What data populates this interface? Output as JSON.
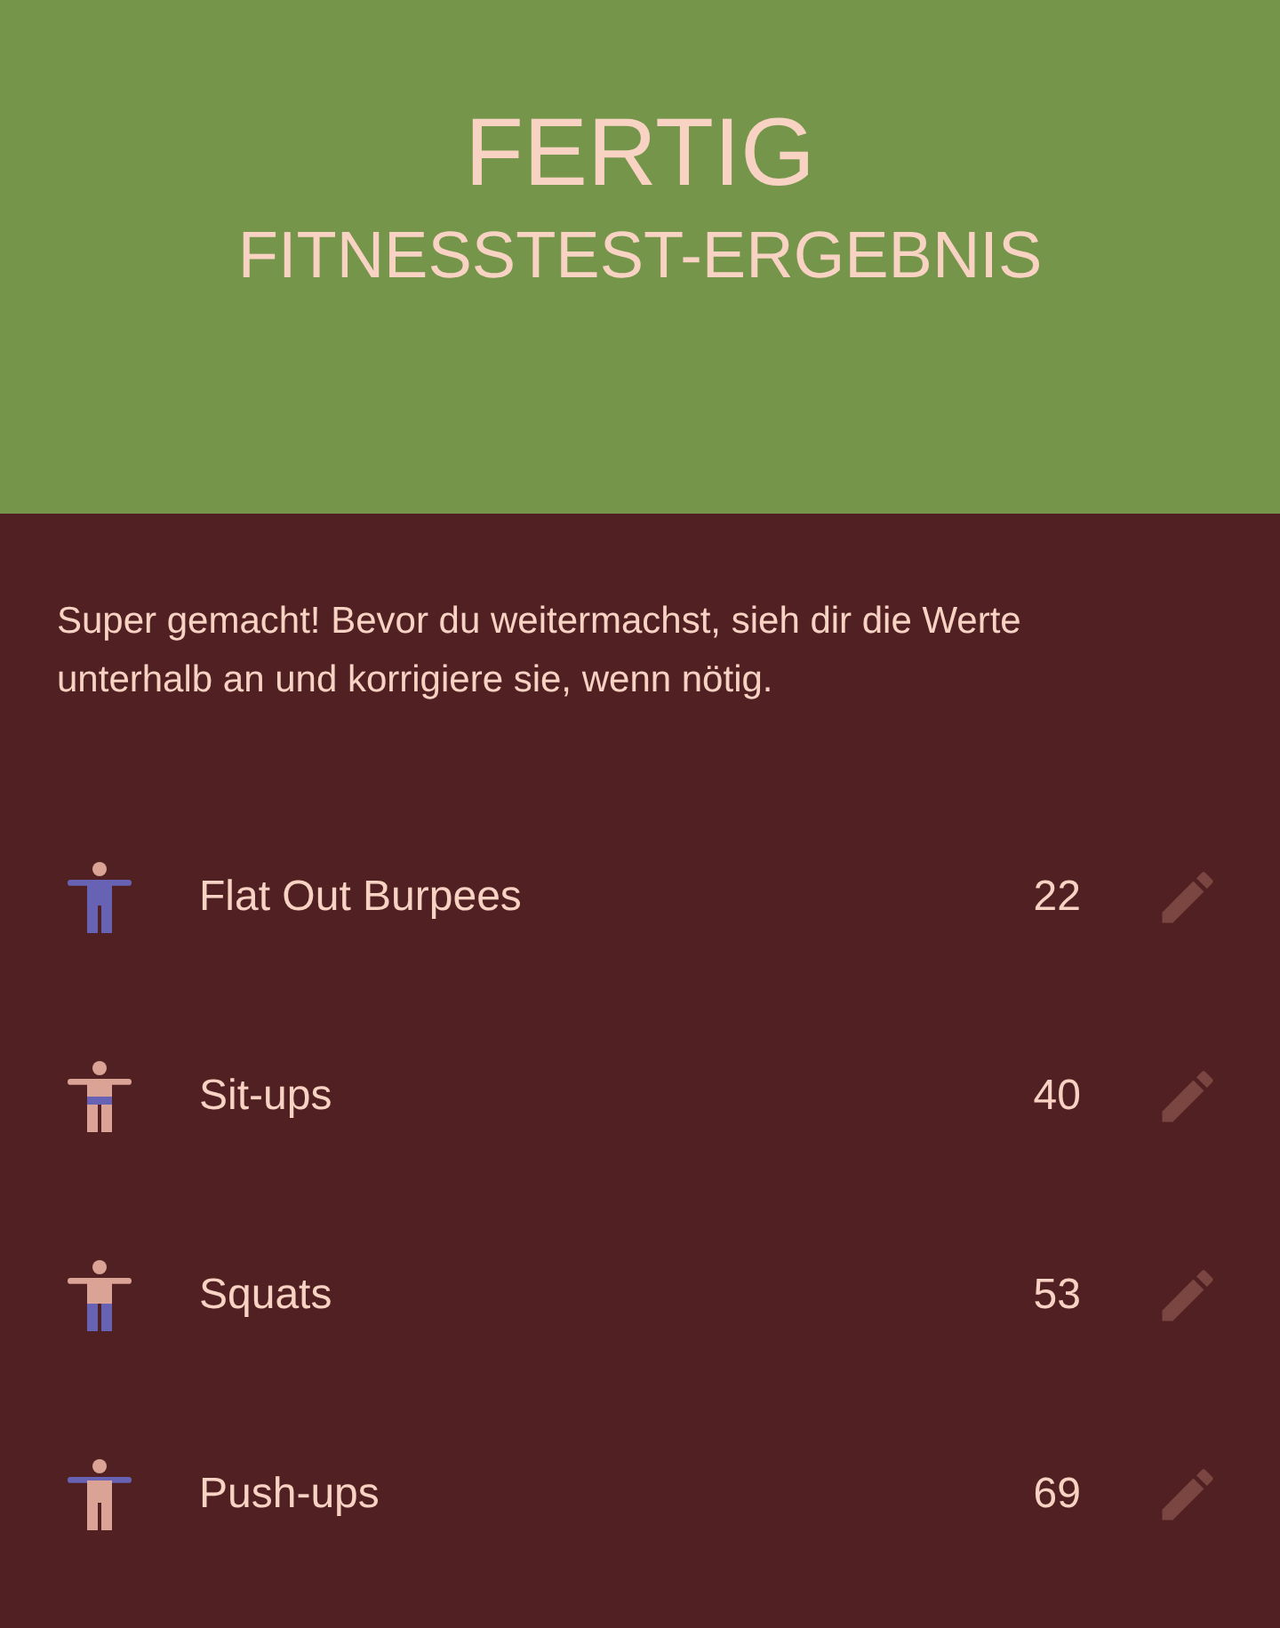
{
  "header": {
    "title": "FERTIG",
    "subtitle": "FITNESSTEST-ERGEBNIS"
  },
  "intro": "Super gemacht! Bevor du weitermachst, sieh dir die Werte unterhalb an und korrigiere sie, wenn nötig.",
  "exercises": [
    {
      "name": "Flat Out Burpees",
      "value": "22",
      "kind": "full"
    },
    {
      "name": "Sit-ups",
      "value": "40",
      "kind": "core"
    },
    {
      "name": "Squats",
      "value": "53",
      "kind": "legs"
    },
    {
      "name": "Push-ups",
      "value": "69",
      "kind": "arms"
    }
  ]
}
